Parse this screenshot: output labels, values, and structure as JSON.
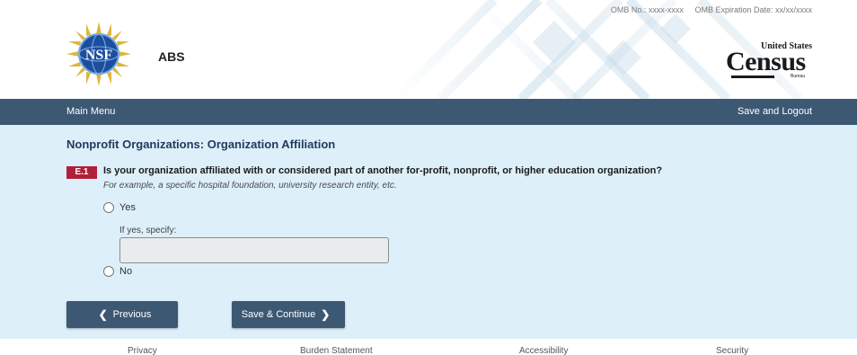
{
  "header": {
    "omb_number": "OMB No.: xxxx-xxxx",
    "omb_expiration": "OMB Expiration Date: xx/xx/xxxx",
    "app_title": "ABS",
    "nsf_logo_text": "NSF",
    "census_logo": {
      "top": "United States",
      "main": "Census",
      "sub": "Bureau"
    }
  },
  "nav": {
    "main_menu": "Main Menu",
    "save_logout": "Save and Logout"
  },
  "main": {
    "section_title": "Nonprofit Organizations: Organization Affiliation",
    "question": {
      "id": "E.1",
      "text": "Is your organization affiliated with or considered part of another for-profit, nonprofit, or higher education organization?",
      "hint": "For example, a specific hospital foundation, university research entity, etc.",
      "options": {
        "yes": "Yes",
        "no": "No"
      },
      "specify_label": "If yes, specify:",
      "specify_value": ""
    },
    "buttons": {
      "previous": "Previous",
      "save_continue": "Save & Continue"
    }
  },
  "footer": {
    "privacy": "Privacy",
    "burden": "Burden Statement",
    "accessibility": "Accessibility",
    "security": "Security"
  },
  "colors": {
    "nav": "#3c5873",
    "content_bg": "#ddeff9",
    "badge": "#b21f3a",
    "title": "#1f3a5c"
  }
}
